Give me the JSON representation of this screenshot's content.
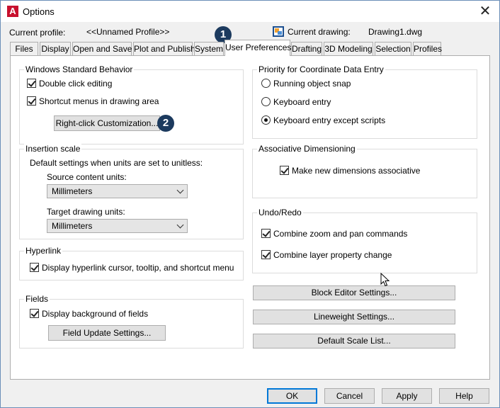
{
  "window": {
    "title": "Options",
    "app_icon_glyph": "A"
  },
  "profile": {
    "current_profile_label": "Current profile:",
    "current_profile_value": "<<Unnamed Profile>>",
    "current_drawing_label": "Current drawing:",
    "current_drawing_value": "Drawing1.dwg"
  },
  "callouts": {
    "one": "1",
    "two": "2"
  },
  "tabs": [
    {
      "label": "Files"
    },
    {
      "label": "Display"
    },
    {
      "label": "Open and Save"
    },
    {
      "label": "Plot and Publish"
    },
    {
      "label": "System"
    },
    {
      "label": "User Preferences"
    },
    {
      "label": "Drafting"
    },
    {
      "label": "3D Modeling"
    },
    {
      "label": "Selection"
    },
    {
      "label": "Profiles"
    }
  ],
  "windows_behavior": {
    "title": "Windows Standard Behavior",
    "double_click": "Double click editing",
    "shortcut_menus": "Shortcut menus in drawing area",
    "right_click_button": "Right-click Customization..."
  },
  "insertion_scale": {
    "title": "Insertion scale",
    "description": "Default settings when units are set to unitless:",
    "source_label": "Source content units:",
    "source_value": "Millimeters",
    "target_label": "Target drawing units:",
    "target_value": "Millimeters"
  },
  "hyperlink": {
    "title": "Hyperlink",
    "display": "Display hyperlink cursor, tooltip, and shortcut menu"
  },
  "fields": {
    "title": "Fields",
    "display_background": "Display background of fields",
    "update_button": "Field Update Settings..."
  },
  "priority": {
    "title": "Priority for Coordinate Data Entry",
    "options": [
      "Running object snap",
      "Keyboard entry",
      "Keyboard entry except scripts"
    ]
  },
  "assoc_dim": {
    "title": "Associative Dimensioning",
    "make_new": "Make new dimensions associative"
  },
  "undo_redo": {
    "title": "Undo/Redo",
    "combine_zoom": "Combine zoom and pan commands",
    "combine_layer": "Combine layer property change"
  },
  "right_buttons": {
    "block_editor": "Block Editor Settings...",
    "lineweight": "Lineweight Settings...",
    "default_scale": "Default Scale List..."
  },
  "footer": {
    "ok": "OK",
    "cancel": "Cancel",
    "apply": "Apply",
    "help": "Help"
  }
}
